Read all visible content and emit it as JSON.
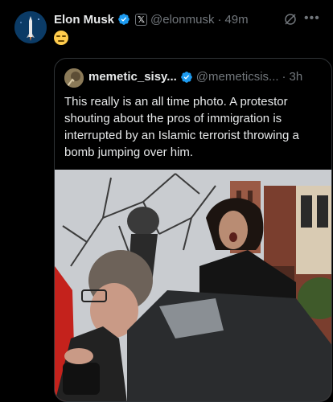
{
  "tweet": {
    "author_name": "Elon Musk",
    "handle": "@elonmusk",
    "separator": "·",
    "time": "49m",
    "emoji": "expressionless-face-emoji",
    "icons": [
      "verified-badge-icon",
      "x-affiliation-icon",
      "grok-icon",
      "more-icon"
    ]
  },
  "quoted": {
    "author_name": "memetic_sisy...",
    "handle": "@memeticsis...",
    "separator": "·",
    "time": "3h",
    "text": "This really is an all time photo. A protestor shouting about the pros of immigration is interrupted by an Islamic terrorist throwing a bomb jumping over him."
  },
  "colors": {
    "background": "#000000",
    "verified": "#1d9bf0",
    "secondary_text": "#71767b"
  }
}
